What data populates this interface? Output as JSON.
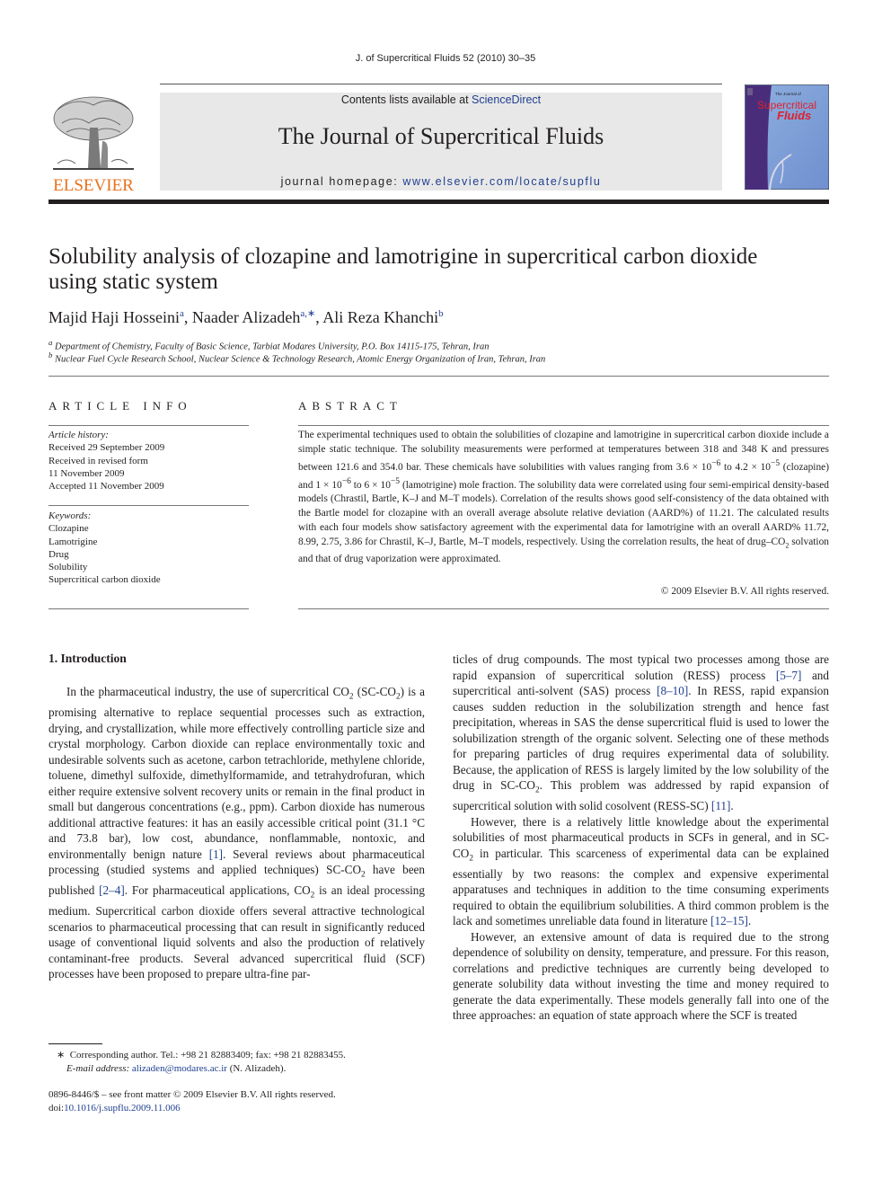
{
  "running_head": "J. of Supercritical Fluids 52 (2010) 30–35",
  "masthead": {
    "contents_prefix": "Contents lists available at ",
    "contents_link": "ScienceDirect",
    "journal_title": "The Journal of Supercritical Fluids",
    "homepage_prefix": "journal homepage: ",
    "homepage_link": "www.elsevier.com/locate/supflu",
    "publisher_logo_text": "ELSEVIER",
    "cover_title_small": "The Journal of",
    "cover_title_line1": "Supercritical",
    "cover_title_line2": "Fluids"
  },
  "colors": {
    "link": "#1f3f8f",
    "elsevier_orange": "#e9711c",
    "masthead_bg": "#e8e8e8",
    "cover_purple": "#4a2d7a",
    "cover_blue": "#7f9fd6",
    "cover_red": "#e0202a"
  },
  "article": {
    "title": "Solubility analysis of clozapine and lamotrigine in supercritical carbon dioxide using static system",
    "authors": [
      {
        "name": "Majid Haji Hosseini",
        "sup": "a"
      },
      {
        "name": "Naader Alizadeh",
        "sup": "a,∗"
      },
      {
        "name": "Ali Reza Khanchi",
        "sup": "b"
      }
    ],
    "affiliations": [
      {
        "mark": "a",
        "text": "Department of Chemistry, Faculty of Basic Science, Tarbiat Modares University, P.O. Box 14115-175, Tehran, Iran"
      },
      {
        "mark": "b",
        "text": "Nuclear Fuel Cycle Research School, Nuclear Science & Technology Research, Atomic Energy Organization of Iran, Tehran, Iran"
      }
    ]
  },
  "article_info": {
    "heading": "ARTICLE INFO",
    "history_label": "Article history:",
    "history": [
      "Received 29 September 2009",
      "Received in revised form",
      "11 November 2009",
      "Accepted 11 November 2009"
    ],
    "keywords_label": "Keywords:",
    "keywords": [
      "Clozapine",
      "Lamotrigine",
      "Drug",
      "Solubility",
      "Supercritical carbon dioxide"
    ]
  },
  "abstract": {
    "heading": "ABSTRACT",
    "p1": "The experimental techniques used to obtain the solubilities of clozapine and lamotrigine in supercritical carbon dioxide include a simple static technique. The solubility measurements were performed at temperatures between 318 and 348 K and pressures between 121.6 and 354.0 bar. These chemicals have solubilities with values ranging from 3.6 × 10",
    "e1": "−6",
    "p2": " to 4.2 × 10",
    "e2": "−5",
    "p3": " (clozapine) and 1 × 10",
    "e3": "−6",
    "p4": " to 6 × 10",
    "e4": "−5",
    "p5": " (lamotrigine) mole fraction. The solubility data were correlated using four semi-empirical density-based models (Chrastil, Bartle, K–J and M–T models). Correlation of the results shows good self-consistency of the data obtained with the Bartle model for clozapine with an overall average absolute relative deviation (AARD%) of 11.21. The calculated results with each four models show satisfactory agreement with the experimental data for lamotrigine with an overall AARD% 11.72, 8.99, 2.75, 3.86 for Chrastil, K–J, Bartle, M–T models, respectively. Using the correlation results, the heat of drug–CO",
    "sub": "2",
    "p6": " solvation and that of drug vaporization were approximated.",
    "copyright": "© 2009 Elsevier B.V. All rights reserved."
  },
  "body": {
    "section_heading": "1.  Introduction",
    "left": {
      "a": "In the pharmaceutical industry, the use of supercritical CO",
      "b": " (SC-CO",
      "c": ") is a promising alternative to replace sequential processes such as extraction, drying, and crystallization, while more effectively controlling particle size and crystal morphology. Carbon dioxide can replace environmentally toxic and undesirable solvents such as acetone, carbon tetrachloride, methylene chloride, toluene, dimethyl sulfoxide, dimethylformamide, and tetrahydrofuran, which either require extensive solvent recovery units or remain in the final product in small but dangerous concentrations (e.g., ppm). Carbon dioxide has numerous additional attractive features: it has an easily accessible critical point (31.1 °C and 73.8 bar), low cost, abundance, nonflammable, nontoxic, and environmentally benign nature ",
      "ref1": "[1]",
      "d": ". Several reviews about pharmaceutical processing (studied systems and applied techniques) SC-CO",
      "e": " have been published ",
      "ref2": "[2–4]",
      "f": ". For pharmaceutical applications, CO",
      "g": " is an ideal processing medium. Supercritical carbon dioxide offers several attractive technological scenarios to pharmaceutical processing that can result in significantly reduced usage of conventional liquid solvents and also the production of relatively contaminant-free products. Several advanced supercritical fluid (SCF) processes have been proposed to prepare ultra-fine par-",
      "sub": "2"
    },
    "right": {
      "p1a": "ticles of drug compounds. The most typical two processes among those are rapid expansion of supercritical solution (RESS) process ",
      "ref1": "[5–7]",
      "p1b": " and supercritical anti-solvent (SAS) process ",
      "ref2": "[8–10]",
      "p1c": ". In RESS, rapid expansion causes sudden reduction in the solubilization strength and hence fast precipitation, whereas in SAS the dense supercritical fluid is used to lower the solubilization strength of the organic solvent. Selecting one of these methods for preparing particles of drug requires experimental data of solubility. Because, the application of RESS is largely limited by the low solubility of the drug in SC-CO",
      "p1d": ". This problem was addressed by rapid expansion of supercritical solution with solid cosolvent (RESS-SC) ",
      "ref3": "[11]",
      "p1e": ".",
      "p2a": "However, there is a relatively little knowledge about the experimental solubilities of most pharmaceutical products in SCFs in general, and in SC-CO",
      "p2b": " in particular. This scarceness of experimental data can be explained essentially by two reasons: the complex and expensive experimental apparatuses and techniques in addition to the time consuming experiments required to obtain the equilibrium solubilities. A third common problem is the lack and sometimes unreliable data found in literature ",
      "ref4": "[12–15]",
      "p2c": ".",
      "p3": "However, an extensive amount of data is required due to the strong dependence of solubility on density, temperature, and pressure. For this reason, correlations and predictive techniques are currently being developed to generate solubility data without investing the time and money required to generate the data experimentally. These models generally fall into one of the three approaches: an equation of state approach where the SCF is treated",
      "sub": "2"
    }
  },
  "footnote": {
    "mark": "∗",
    "text": "Corresponding author. Tel.: +98 21 82883409; fax: +98 21 82883455.",
    "email_label": "E-mail address:",
    "email": "alizaden@modares.ac.ir",
    "email_suffix": " (N. Alizadeh)."
  },
  "front_matter": {
    "line1": "0896-8446/$ – see front matter © 2009 Elsevier B.V. All rights reserved.",
    "doi_prefix": "doi:",
    "doi": "10.1016/j.supflu.2009.11.006"
  }
}
